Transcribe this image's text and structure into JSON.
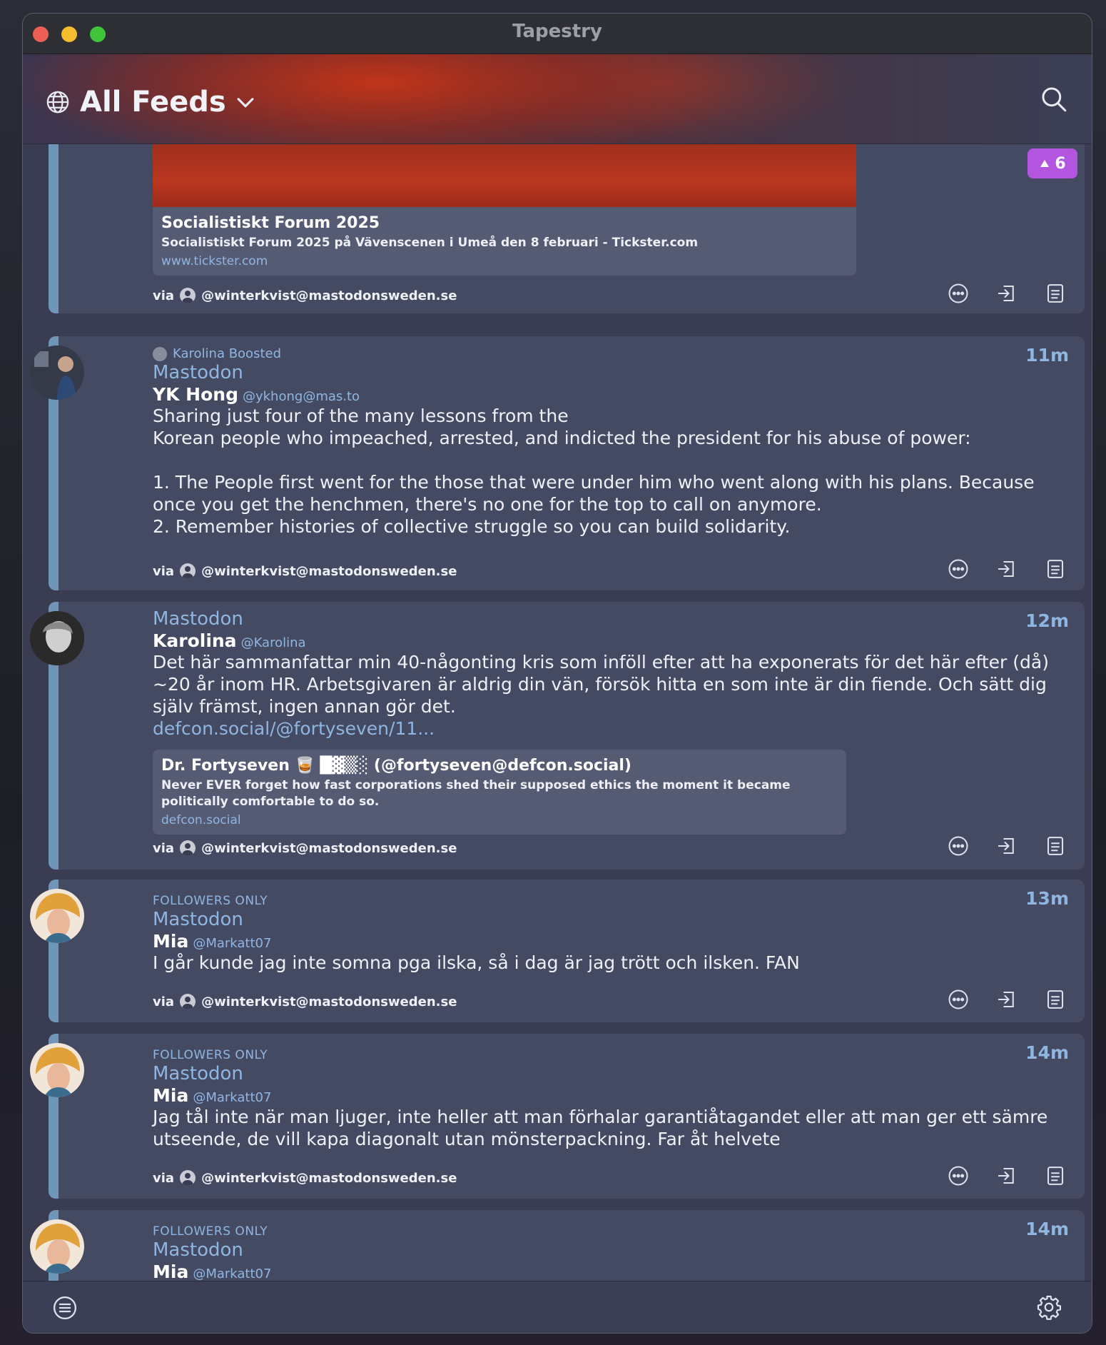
{
  "window": {
    "title": "Tapestry"
  },
  "header": {
    "feed_title": "All Feeds"
  },
  "posts": [
    {
      "link_card": {
        "title": "Socialistiskt Forum 2025",
        "description": "Socialistiskt Forum 2025 på Vävenscenen i Umeå den 8 februari - Tickster.com",
        "url": "www.tickster.com"
      },
      "badge_count": "6",
      "via_label": "via",
      "via_account": "@winterkvist@mastodonsweden.se"
    },
    {
      "boost_label": "Karolina Boosted",
      "network": "Mastodon",
      "time": "11m",
      "author": "YK Hong",
      "handle": "@ykhong@mas.to",
      "body": "Sharing just four of the many lessons from the\nKorean people who impeached, arrested, and indicted the president for his abuse of power:\n\n1. The People first went for the those that were under him who went along with his plans. Because once you get the henchmen, there's no one for the top to call on anymore.\n2. Remember histories of collective struggle so you can build solidarity.",
      "via_label": "via",
      "via_account": "@winterkvist@mastodonsweden.se"
    },
    {
      "network": "Mastodon",
      "time": "12m",
      "author": "Karolina",
      "handle": "@Karolina",
      "body": "Det här sammanfattar min 40-någonting kris som inföll efter att ha exponerats för det här efter (då) ~20 år inom HR. Arbetsgivaren är aldrig din vän, försök hitta en som inte är din fiende. Och sätt dig själv främst, ingen annan gör det.",
      "body_link": "defcon.social/@fortyseven/11...",
      "link_card": {
        "title": "Dr. Fortyseven 🥃 █▓▒░ (@fortyseven@defcon.social)",
        "description": "Never EVER forget how fast corporations shed their supposed ethics the moment it became politically comfortable to do so.",
        "url": "defcon.social"
      },
      "via_label": "via",
      "via_account": "@winterkvist@mastodonsweden.se"
    },
    {
      "visibility": "FOLLOWERS ONLY",
      "network": "Mastodon",
      "time": "13m",
      "author": "Mia",
      "handle": "@Markatt07",
      "body": "I går kunde jag inte somna pga ilska, så i dag är jag trött och ilsken. FAN",
      "via_label": "via",
      "via_account": "@winterkvist@mastodonsweden.se"
    },
    {
      "visibility": "FOLLOWERS ONLY",
      "network": "Mastodon",
      "time": "14m",
      "author": "Mia",
      "handle": "@Markatt07",
      "body": "Jag tål inte när man ljuger, inte heller att man förhalar garantiåtagandet eller att man ger ett sämre utseende, de vill kapa diagonalt utan mönsterpackning. Far åt helvete",
      "via_label": "via",
      "via_account": "@winterkvist@mastodonsweden.se"
    },
    {
      "visibility": "FOLLOWERS ONLY",
      "network": "Mastodon",
      "time": "14m",
      "author": "Mia",
      "handle": "@Markatt07"
    }
  ],
  "icons": {
    "header": [
      "globe-icon",
      "chevron-down-icon",
      "search-icon"
    ],
    "post_actions": [
      "more-options-icon",
      "open-in-icon",
      "reader-icon"
    ],
    "bottom": [
      "list-icon",
      "gear-icon"
    ],
    "badge": "arrow-up-icon"
  },
  "colors": {
    "accent": "#8fb6e0",
    "badge": "#b455e0",
    "card": "#454a63",
    "card_stripe": "#6f95b8"
  }
}
